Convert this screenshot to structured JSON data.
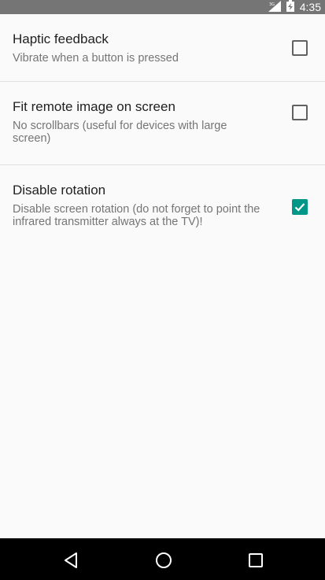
{
  "status_bar": {
    "time": "4:35",
    "icons": [
      "signal-icon",
      "battery-icon"
    ]
  },
  "settings": [
    {
      "title": "Haptic feedback",
      "summary": "Vibrate when a button is pressed",
      "checked": false
    },
    {
      "title": "Fit remote image on screen",
      "summary": "No scrollbars (useful for devices with large screen)",
      "checked": false
    },
    {
      "title": "Disable rotation",
      "summary": "Disable screen rotation (do not forget to point the infrared transmitter always at the TV)!",
      "checked": true
    }
  ],
  "colors": {
    "accent": "#009688",
    "status_bar": "#757575",
    "background": "#fafafa",
    "nav_bar": "#000000"
  },
  "nav_bar": {
    "buttons": [
      "back-icon",
      "home-icon",
      "recents-icon"
    ]
  }
}
